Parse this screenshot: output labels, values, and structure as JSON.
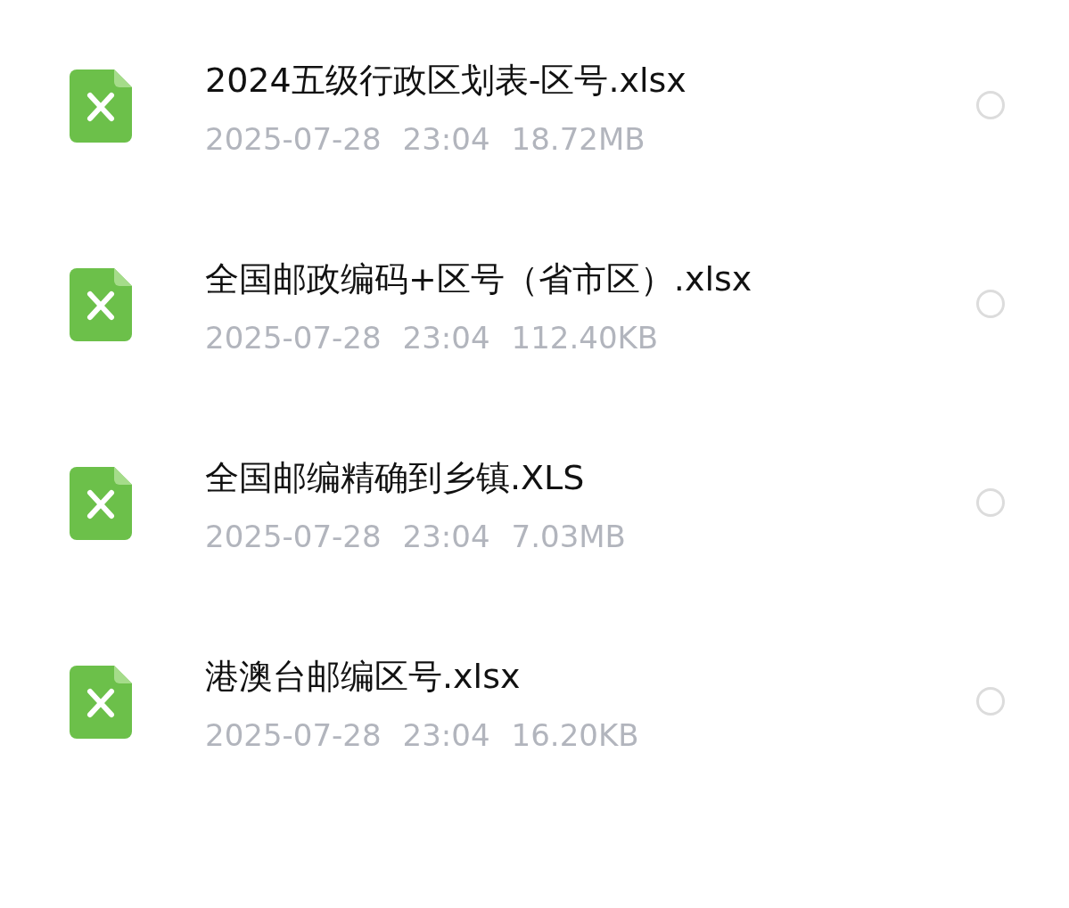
{
  "files": [
    {
      "name": "2024五级行政区划表-区号.xlsx",
      "date": "2025-07-28",
      "time": "23:04",
      "size": "18.72MB",
      "selected": false
    },
    {
      "name": "全国邮政编码+区号（省市区）.xlsx",
      "date": "2025-07-28",
      "time": "23:04",
      "size": "112.40KB",
      "selected": false
    },
    {
      "name": "全国邮编精确到乡镇.XLS",
      "date": "2025-07-28",
      "time": "23:04",
      "size": "7.03MB",
      "selected": false
    },
    {
      "name": "港澳台邮编区号.xlsx",
      "date": "2025-07-28",
      "time": "23:04",
      "size": "16.20KB",
      "selected": false
    }
  ]
}
